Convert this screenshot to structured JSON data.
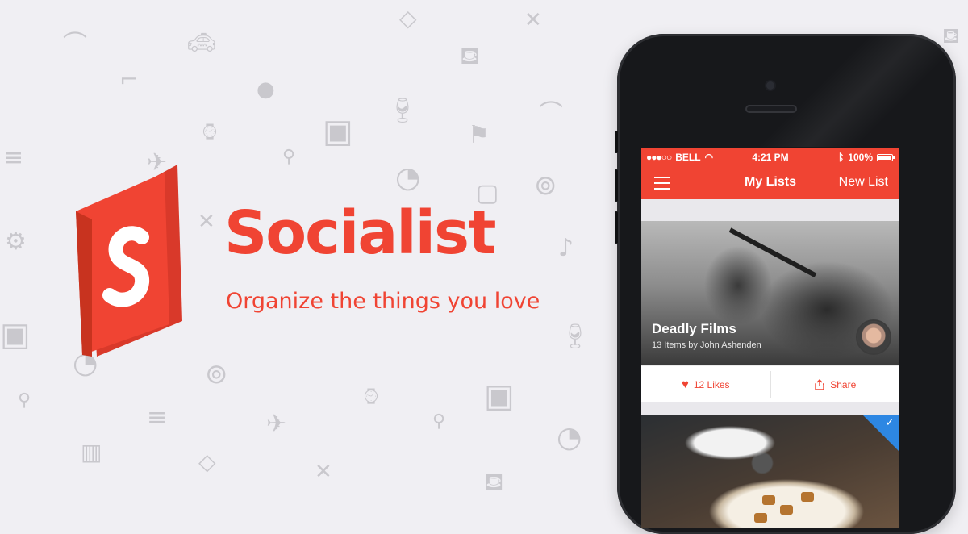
{
  "colors": {
    "brand_red": "#f04433",
    "background": "#f0eff3",
    "pattern": "#c9c8cd",
    "check_blue": "#2d87e3"
  },
  "brand": {
    "name": "Socialist",
    "tagline": "Organize the things you love",
    "logo_icon": "book-s-logo-icon"
  },
  "status_bar": {
    "carrier": "BELL",
    "time": "4:21 PM",
    "battery": "100%"
  },
  "nav": {
    "title": "My Lists",
    "action": "New List",
    "menu_icon": "hamburger-menu-icon"
  },
  "cards": [
    {
      "title": "Deadly Films",
      "subtitle": "13 Items by John Ashenden",
      "likes_label": "12 Likes",
      "share_label": "Share"
    }
  ],
  "second_card": {
    "checked": true
  }
}
